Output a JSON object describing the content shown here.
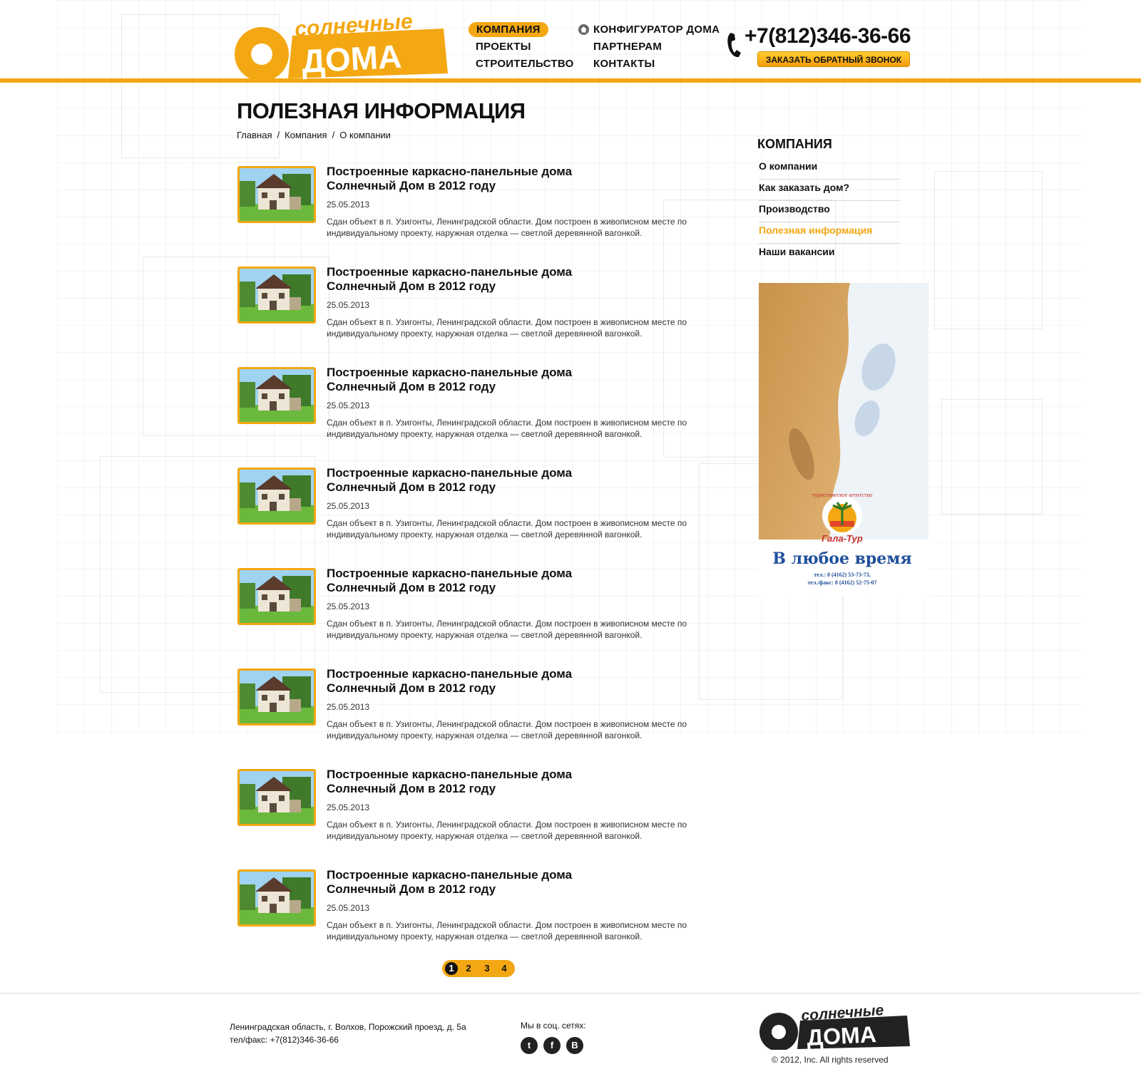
{
  "header": {
    "logo_top": "солнечные",
    "logo_bottom": "ДОМА",
    "nav_col1": [
      "КОМПАНИЯ",
      "ПРОЕКТЫ",
      "СТРОИТЕЛЬСТВО"
    ],
    "nav_col2": [
      "КОНФИГУРАТОР ДОМА",
      "ПАРТНЕРАМ",
      "КОНТАКТЫ"
    ],
    "phone": "+7(812)346-36-66",
    "callback_label": "ЗАКАЗАТЬ ОБРАТНЫЙ ЗВОНОК",
    "accent_color": "#f3a712"
  },
  "page": {
    "title": "ПОЛЕЗНАЯ ИНФОРМАЦИЯ",
    "breadcrumb": [
      "Главная",
      "Компания",
      "О компании"
    ],
    "breadcrumb_separator": "/"
  },
  "items": [
    {
      "title_line1": "Построенные каркасно-панельные дома",
      "title_line2": "Солнечный Дом в 2012 году",
      "date": "25.05.2013",
      "text_line1": "Сдан объект в п. Узигонты, Ленинградской области. Дом построен в живописном месте по",
      "text_line2": "индивидуальному проекту, наружная отделка — светлой деревянной вагонкой."
    },
    {
      "title_line1": "Построенные каркасно-панельные дома",
      "title_line2": "Солнечный Дом в 2012 году",
      "date": "25.05.2013",
      "text_line1": "Сдан объект в п. Узигонты, Ленинградской области. Дом построен в живописном месте по",
      "text_line2": "индивидуальному проекту, наружная отделка — светлой деревянной вагонкой."
    },
    {
      "title_line1": "Построенные каркасно-панельные дома",
      "title_line2": "Солнечный Дом в 2012 году",
      "date": "25.05.2013",
      "text_line1": "Сдан объект в п. Узигонты, Ленинградской области. Дом построен в живописном месте по",
      "text_line2": "индивидуальному проекту, наружная отделка — светлой деревянной вагонкой."
    },
    {
      "title_line1": "Построенные каркасно-панельные дома",
      "title_line2": "Солнечный Дом в 2012 году",
      "date": "25.05.2013",
      "text_line1": "Сдан объект в п. Узигонты, Ленинградской области. Дом построен в живописном месте по",
      "text_line2": "индивидуальному проекту, наружная отделка — светлой деревянной вагонкой."
    },
    {
      "title_line1": "Построенные каркасно-панельные дома",
      "title_line2": "Солнечный Дом в 2012 году",
      "date": "25.05.2013",
      "text_line1": "Сдан объект в п. Узигонты, Ленинградской области. Дом построен в живописном месте по",
      "text_line2": "индивидуальному проекту, наружная отделка — светлой деревянной вагонкой."
    },
    {
      "title_line1": "Построенные каркасно-панельные дома",
      "title_line2": "Солнечный Дом в 2012 году",
      "date": "25.05.2013",
      "text_line1": "Сдан объект в п. Узигонты, Ленинградской области. Дом построен в живописном месте по",
      "text_line2": "индивидуальному проекту, наружная отделка — светлой деревянной вагонкой."
    },
    {
      "title_line1": "Построенные каркасно-панельные дома",
      "title_line2": "Солнечный Дом в 2012 году",
      "date": "25.05.2013",
      "text_line1": "Сдан объект в п. Узигонты, Ленинградской области. Дом построен в живописном месте по",
      "text_line2": "индивидуальному проекту, наружная отделка — светлой деревянной вагонкой."
    },
    {
      "title_line1": "Построенные каркасно-панельные дома",
      "title_line2": "Солнечный Дом в 2012 году",
      "date": "25.05.2013",
      "text_line1": "Сдан объект в п. Узигонты, Ленинградской области. Дом построен в живописном месте по",
      "text_line2": "индивидуальному проекту, наружная отделка — светлой деревянной вагонкой."
    }
  ],
  "pagination": {
    "pages": [
      "1",
      "2",
      "3",
      "4"
    ],
    "current": "1"
  },
  "sidebar": {
    "title": "КОМПАНИЯ",
    "items": [
      "О компании",
      "Как заказать дом?",
      "Производство",
      "Полезная информация",
      "Наши вакансии"
    ],
    "active_index": 3
  },
  "ad": {
    "brand_arc": "туристическое агентство",
    "brand": "Гала-Тур",
    "slogan": "В любое время",
    "tel": "тел.: 8 (4162) 53-73-73,",
    "fax": "тел./факс: 8 (4162) 52-75-07"
  },
  "footer": {
    "address": "Ленинградская область, г. Волхов, Порожский проезд, д. 5а",
    "telfax": "тел/факс: +7(812)346-36-66",
    "social_label": "Мы в соц. сетях:",
    "social_icons": [
      "twitter-icon",
      "facebook-icon",
      "blogger-icon"
    ],
    "logo_top": "солнечные",
    "logo_bottom": "ДОМА",
    "copyright": "© 2012, Inc. All rights reserved"
  }
}
